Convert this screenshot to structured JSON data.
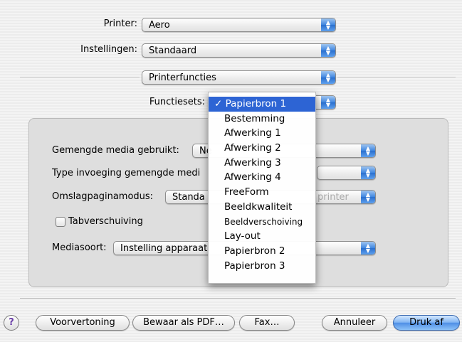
{
  "top": {
    "printer_label": "Printer:",
    "printer_value": "Aero",
    "settings_label": "Instellingen:",
    "settings_value": "Standaard",
    "section_value": "Printerfuncties",
    "featuresets_label": "Functiesets:"
  },
  "panel": {
    "mixed_media_label": "Gemengde media gebruikt:",
    "mixed_media_value": "Ne",
    "insert_type_label": "Type invoeging gemengde medi",
    "cover_mode_label": "Omslagpaginamodus:",
    "cover_mode_value": "Standa",
    "cover_mode_value_tail": "printer",
    "tab_shift_label": "Tabverschuiving",
    "media_type_label": "Mediasoort:",
    "media_type_value": "Instelling apparaat"
  },
  "menu": {
    "items": [
      "Papierbron 1",
      "Bestemming",
      "Afwerking 1",
      "Afwerking 2",
      "Afwerking 3",
      "Afwerking 4",
      "FreeForm",
      "Beeldkwaliteit",
      "Beeldverschoiving",
      "Lay-out",
      "Papierbron 2",
      "Papierbron 3"
    ],
    "selected_index": 0,
    "checkmark": "✓"
  },
  "buttons": {
    "help": "?",
    "preview": "Voorvertoning",
    "save_pdf": "Bewaar als PDF…",
    "fax": "Fax…",
    "cancel": "Annuleer",
    "print": "Druk af"
  }
}
